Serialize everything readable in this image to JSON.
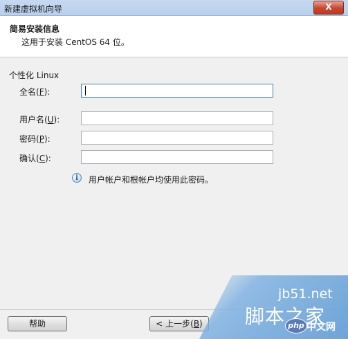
{
  "window": {
    "title": "新建虚拟机向导",
    "close_label": "X"
  },
  "header": {
    "title": "简易安装信息",
    "subtitle": "这用于安装 CentOS 64 位。"
  },
  "group": {
    "label": "个性化 Linux"
  },
  "fields": {
    "fullname": {
      "label_pre": "全名(",
      "key": "F",
      "label_post": "):",
      "value": ""
    },
    "username": {
      "label_pre": "用户名(",
      "key": "U",
      "label_post": "):",
      "value": ""
    },
    "password": {
      "label_pre": "密码(",
      "key": "P",
      "label_post": "):",
      "value": ""
    },
    "confirm": {
      "label_pre": "确认(",
      "key": "C",
      "label_post": "):",
      "value": ""
    }
  },
  "info": {
    "icon": "info-icon",
    "text": "用户帐户和根帐户均使用此密码。"
  },
  "buttons": {
    "help": "帮助",
    "back_pre": "< 上一步(",
    "back_key": "B",
    "back_post": ")"
  },
  "watermark": {
    "site": "jb51.net",
    "name": "脚本之家",
    "badge": "php",
    "badge_text": "中文网"
  }
}
